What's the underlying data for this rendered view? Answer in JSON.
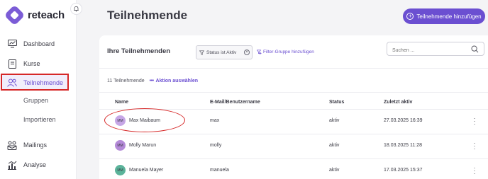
{
  "app": {
    "logo_text": "reteach"
  },
  "sidebar": {
    "items": [
      {
        "label": "Dashboard",
        "icon": "dashboard-icon"
      },
      {
        "label": "Kurse",
        "icon": "book-icon"
      },
      {
        "label": "Teilnehmende",
        "icon": "users-icon",
        "active": true
      },
      {
        "label": "Gruppen"
      },
      {
        "label": "Importieren"
      },
      {
        "label": "Mailings",
        "icon": "mail-icon"
      },
      {
        "label": "Analyse",
        "icon": "chart-icon"
      }
    ]
  },
  "header": {
    "title": "Teilnehmende",
    "add_button": "Teilnehmende hinzufügen"
  },
  "list": {
    "title": "Ihre Teilnehmenden",
    "filter_chip": "Status ist Aktiv",
    "add_filter": "Filter-Gruppe hinzufügen",
    "search_placeholder": "Suchen ...",
    "count": "11 Teilnehmende",
    "action_label": "Aktion auswählen",
    "columns": [
      "Name",
      "E-Mail/Benutzername",
      "Status",
      "Zuletzt aktiv"
    ],
    "rows": [
      {
        "initials": "MM",
        "name": "Max Maibaum",
        "email": "max",
        "status": "aktiv",
        "last_active": "27.03.2025 16:39",
        "avatar_color": "#b48ad8"
      },
      {
        "initials": "MM",
        "name": "Molly Marun",
        "email": "molly",
        "status": "aktiv",
        "last_active": "18.03.2025 11:28",
        "avatar_color": "#b48ad8"
      },
      {
        "initials": "MM",
        "name": "Manuela Mayer",
        "email": "manuela",
        "status": "aktiv",
        "last_active": "17.03.2025 15:37",
        "avatar_color": "#5bb39a"
      }
    ]
  },
  "colors": {
    "accent": "#6b4fd1",
    "annotation": "#d62828"
  }
}
